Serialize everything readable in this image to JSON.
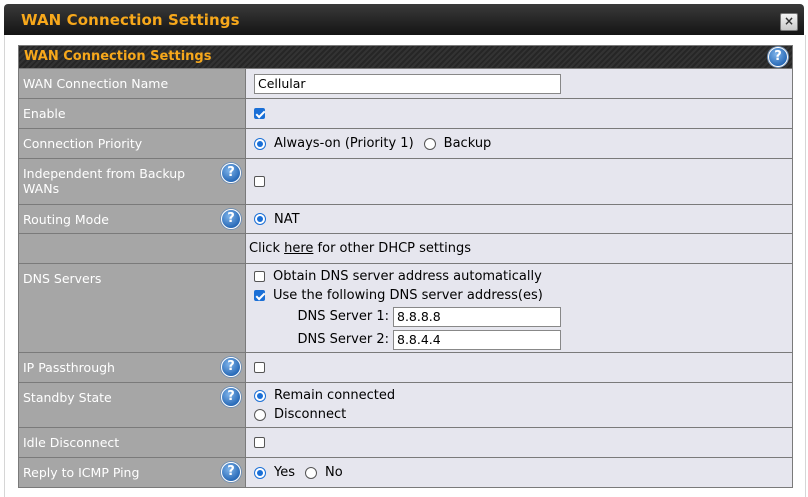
{
  "window": {
    "title": "WAN Connection Settings",
    "close_label": "×"
  },
  "section": {
    "title": "WAN Connection Settings",
    "help": "?"
  },
  "rows": {
    "name": {
      "label": "WAN Connection Name",
      "value": "Cellular"
    },
    "enable": {
      "label": "Enable",
      "checked": true
    },
    "priority": {
      "label": "Connection Priority",
      "opt1": "Always-on (Priority 1)",
      "opt2": "Backup",
      "selected": "opt1"
    },
    "independent": {
      "label": "Independent from Backup WANs",
      "checked": false
    },
    "routing": {
      "label": "Routing Mode",
      "opt1": "NAT"
    },
    "dhcp": {
      "prefix": "Click ",
      "link": "here",
      "suffix": " for other DHCP settings"
    },
    "dns": {
      "label": "DNS Servers",
      "auto_label": "Obtain DNS server address automatically",
      "manual_label": "Use the following DNS server address(es)",
      "server1_label": "DNS Server 1:",
      "server1_value": "8.8.8.8",
      "server2_label": "DNS Server 2:",
      "server2_value": "8.8.4.4"
    },
    "passthrough": {
      "label": "IP Passthrough",
      "checked": false
    },
    "standby": {
      "label": "Standby State",
      "opt1": "Remain connected",
      "opt2": "Disconnect"
    },
    "idle": {
      "label": "Idle Disconnect",
      "checked": false
    },
    "icmp": {
      "label": "Reply to ICMP Ping",
      "opt1": "Yes",
      "opt2": "No"
    }
  },
  "colors": {
    "accent": "#f7a81b",
    "header_bg": "#2b2b2b",
    "label_bg": "#a6a6a6",
    "value_bg": "#e6e6ee",
    "check_blue": "#1a6fd6"
  }
}
